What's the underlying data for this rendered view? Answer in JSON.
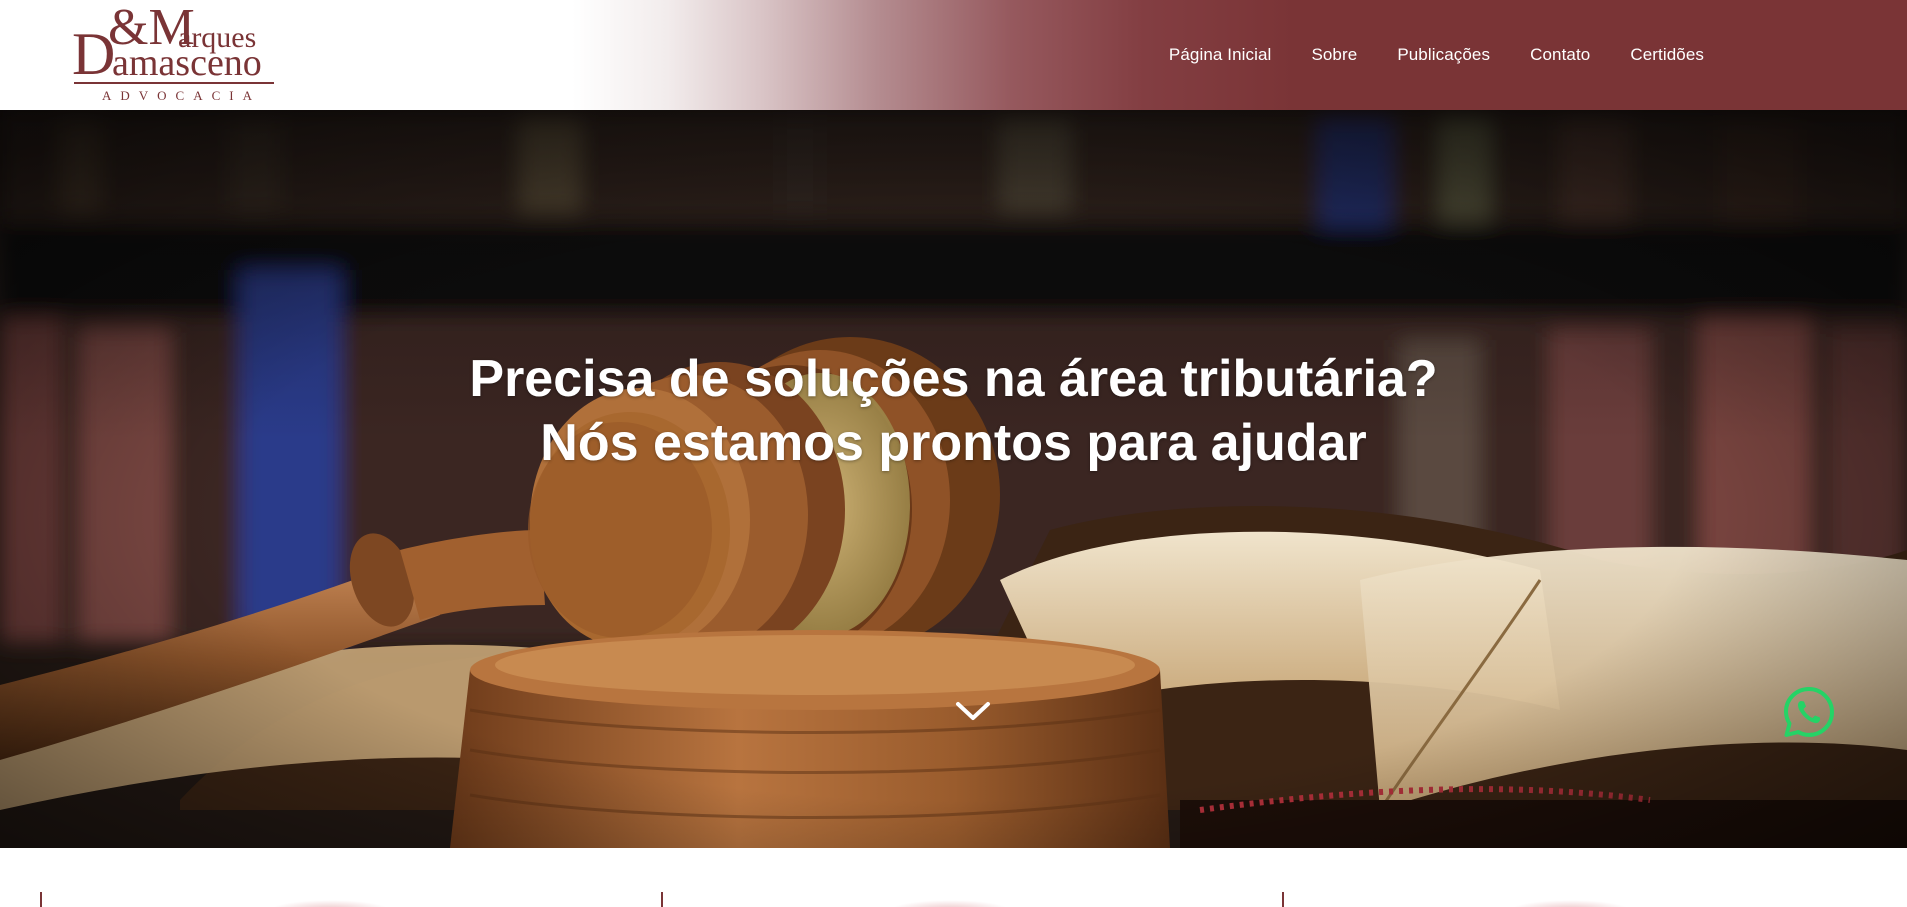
{
  "brand": {
    "logo_letters_top": "&M",
    "logo_letter_d": "D",
    "logo_word_top": "arques",
    "logo_word_bottom": "amasceno",
    "logo_tagline": "ADVOCACIA",
    "color": "#7a3436"
  },
  "nav": {
    "items": [
      "Página Inicial",
      "Sobre",
      "Publicações",
      "Contato",
      "Certidões"
    ]
  },
  "hero": {
    "title_line1": "Precisa de soluções na área tributária?",
    "title_line2": "Nós estamos prontos para ajudar",
    "scroll_icon": "chevron-down-icon"
  },
  "floating": {
    "whatsapp_icon": "whatsapp-icon",
    "whatsapp_color": "#25d366"
  },
  "colors": {
    "accent": "#7a3436",
    "header_gradient_end": "#7a3436"
  }
}
